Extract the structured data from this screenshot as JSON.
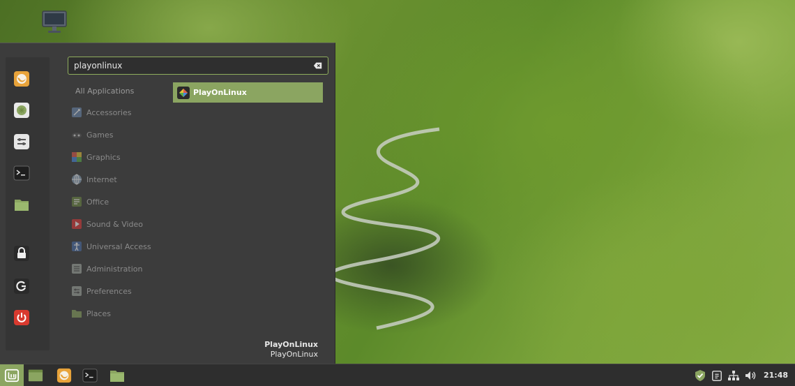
{
  "search": {
    "value": "playonlinux",
    "placeholder": ""
  },
  "favorites": [
    {
      "name": "firefox",
      "icon": "firefox-icon"
    },
    {
      "name": "software-manager",
      "icon": "software-manager-icon"
    },
    {
      "name": "settings",
      "icon": "settings-icon"
    },
    {
      "name": "terminal",
      "icon": "terminal-icon"
    },
    {
      "name": "files",
      "icon": "folder-icon"
    },
    {
      "name": "lock-screen",
      "icon": "lock-icon"
    },
    {
      "name": "logout",
      "icon": "logout-icon"
    },
    {
      "name": "shutdown",
      "icon": "power-icon"
    }
  ],
  "categories": {
    "all": "All Applications",
    "items": [
      {
        "label": "Accessories",
        "icon": "accessories-icon"
      },
      {
        "label": "Games",
        "icon": "games-icon"
      },
      {
        "label": "Graphics",
        "icon": "graphics-icon"
      },
      {
        "label": "Internet",
        "icon": "internet-icon"
      },
      {
        "label": "Office",
        "icon": "office-icon"
      },
      {
        "label": "Sound & Video",
        "icon": "sound-video-icon"
      },
      {
        "label": "Universal Access",
        "icon": "universal-access-icon"
      },
      {
        "label": "Administration",
        "icon": "administration-icon"
      },
      {
        "label": "Preferences",
        "icon": "preferences-icon"
      },
      {
        "label": "Places",
        "icon": "places-icon"
      }
    ]
  },
  "results": [
    {
      "label": "PlayOnLinux",
      "icon": "playonlinux-icon"
    }
  ],
  "info": {
    "name": "PlayOnLinux",
    "description": "PlayOnLinux"
  },
  "taskbar": {
    "clock": "21:48"
  },
  "colors": {
    "accent": "#8ba561",
    "menu_bg": "#3c3c3c",
    "taskbar_bg": "#2e2e2e"
  }
}
